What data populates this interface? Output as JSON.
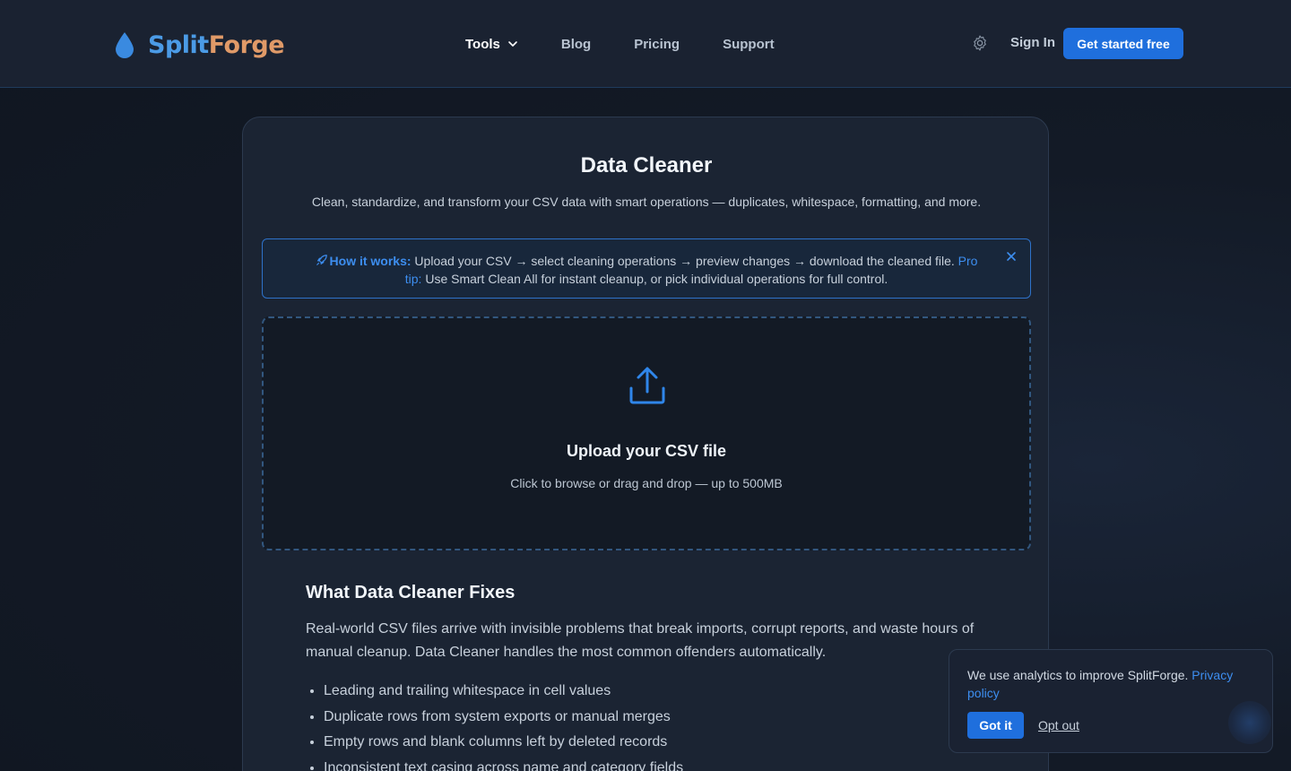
{
  "brand": {
    "name_part1": "Split",
    "name_part2": "Forge"
  },
  "nav": {
    "items": [
      {
        "label": "Tools",
        "has_dropdown": true,
        "active": true
      },
      {
        "label": "Blog"
      },
      {
        "label": "Pricing"
      },
      {
        "label": "Support"
      }
    ],
    "settings_icon": "gear-icon",
    "signin_label": "Sign In",
    "cta_label": "Get started free"
  },
  "tool": {
    "title": "Data Cleaner",
    "subtitle": "Clean, standardize, and transform your CSV data with smart operations — duplicates, whitespace, formatting, and more."
  },
  "info": {
    "icon": "rocket-icon",
    "label": "How it works:",
    "text": " Upload your CSV → select cleaning operations → preview changes → download the cleaned file. ",
    "pro_label": "Pro tip:",
    "pro_text": " Use Smart Clean All for instant cleanup, or pick individual operations for full control."
  },
  "upload": {
    "icon": "upload-icon",
    "title": "Upload your CSV file",
    "subtitle": "Click to browse or drag and drop — up to 500MB"
  },
  "fixes": {
    "heading": "What Data Cleaner Fixes",
    "intro": "Real-world CSV files arrive with invisible problems that break imports, corrupt reports, and waste hours of manual cleanup. Data Cleaner handles the most common offenders automatically.",
    "items": [
      "Leading and trailing whitespace in cell values",
      "Duplicate rows from system exports or manual merges",
      "Empty rows and blank columns left by deleted records",
      "Inconsistent text casing across name and category fields"
    ]
  },
  "cookie": {
    "text": "We use analytics to improve SplitForge. ",
    "link_label": "Privacy policy",
    "accept_label": "Got it",
    "optout_label": "Opt out"
  },
  "colors": {
    "accent": "#1f6fdd",
    "link": "#3d8ef0",
    "logo_split": "#4b9be6",
    "logo_forge": "#e09a68"
  }
}
